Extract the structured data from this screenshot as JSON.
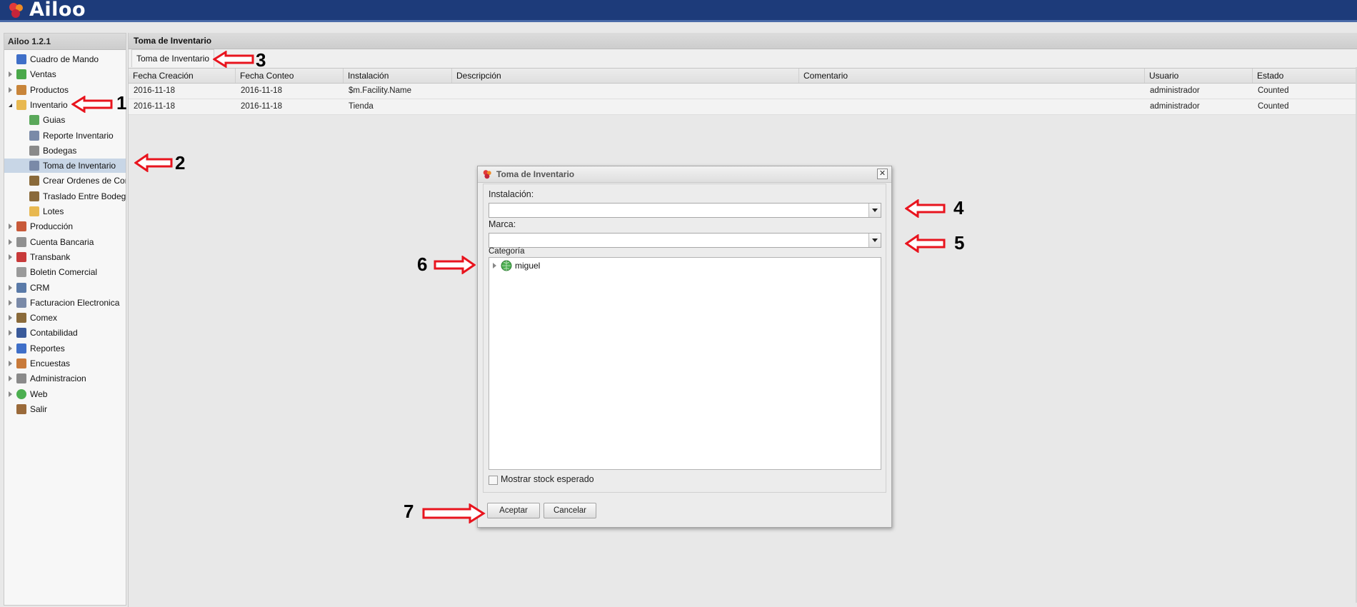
{
  "app": {
    "name": "Ailoo"
  },
  "colors": {
    "topbar": "#1d3b7a",
    "selected": "#c8d6e6",
    "annotation_arrow": "#e8141e"
  },
  "sidebar": {
    "title": "Ailoo 1.2.1",
    "items": [
      {
        "label": "Cuadro de Mando",
        "icon": "chart-icon",
        "expand": "none",
        "indent": 0
      },
      {
        "label": "Ventas",
        "icon": "money-icon",
        "expand": "closed",
        "indent": 0
      },
      {
        "label": "Productos",
        "icon": "box-icon",
        "expand": "closed",
        "indent": 0
      },
      {
        "label": "Inventario",
        "icon": "package-icon",
        "expand": "open",
        "indent": 0
      },
      {
        "label": "Guias",
        "icon": "doc-icon",
        "expand": "none",
        "indent": 1
      },
      {
        "label": "Reporte Inventario",
        "icon": "report-icon",
        "expand": "none",
        "indent": 1
      },
      {
        "label": "Bodegas",
        "icon": "building-icon",
        "expand": "none",
        "indent": 1
      },
      {
        "label": "Toma de Inventario",
        "icon": "report-icon",
        "expand": "none",
        "indent": 1,
        "selected": true
      },
      {
        "label": "Crear Ordenes de Compra",
        "icon": "truck-icon",
        "expand": "none",
        "indent": 1
      },
      {
        "label": "Traslado Entre Bodegas",
        "icon": "truck-icon",
        "expand": "none",
        "indent": 1
      },
      {
        "label": "Lotes",
        "icon": "package-icon",
        "expand": "none",
        "indent": 1
      },
      {
        "label": "Producción",
        "icon": "factory-icon",
        "expand": "closed",
        "indent": 0
      },
      {
        "label": "Cuenta Bancaria",
        "icon": "bank-icon",
        "expand": "closed",
        "indent": 0
      },
      {
        "label": "Transbank",
        "icon": "pin-icon",
        "expand": "closed",
        "indent": 0
      },
      {
        "label": "Boletin Comercial",
        "icon": "tag-icon",
        "expand": "none",
        "indent": 0
      },
      {
        "label": "CRM",
        "icon": "people-icon",
        "expand": "closed",
        "indent": 0
      },
      {
        "label": "Facturacion Electronica",
        "icon": "report-icon",
        "expand": "closed",
        "indent": 0
      },
      {
        "label": "Comex",
        "icon": "truck-icon",
        "expand": "closed",
        "indent": 0
      },
      {
        "label": "Contabilidad",
        "icon": "book-icon",
        "expand": "closed",
        "indent": 0
      },
      {
        "label": "Reportes",
        "icon": "chart-icon",
        "expand": "closed",
        "indent": 0
      },
      {
        "label": "Encuestas",
        "icon": "survey-icon",
        "expand": "closed",
        "indent": 0
      },
      {
        "label": "Administracion",
        "icon": "gear-icon",
        "expand": "closed",
        "indent": 0
      },
      {
        "label": "Web",
        "icon": "globe-icon",
        "expand": "closed",
        "indent": 0
      },
      {
        "label": "Salir",
        "icon": "door-icon",
        "expand": "none",
        "indent": 0
      }
    ]
  },
  "main": {
    "title": "Toma de Inventario",
    "tab": "Toma de Inventario",
    "columns": [
      "Fecha Creación",
      "Fecha Conteo",
      "Instalación",
      "Descripción",
      "Comentario",
      "Usuario",
      "Estado"
    ],
    "rows": [
      [
        "2016-11-18",
        "2016-11-18",
        "$m.Facility.Name",
        "",
        "",
        "administrador",
        "Counted"
      ],
      [
        "2016-11-18",
        "2016-11-18",
        "Tienda",
        "",
        "",
        "administrador",
        "Counted"
      ]
    ]
  },
  "dialog": {
    "title": "Toma de Inventario",
    "close": "✕",
    "instalacion_label": "Instalación:",
    "instalacion_value": "",
    "marca_label": "Marca:",
    "marca_value": "",
    "categoria_label": "Categoría",
    "tree_root": "miguel",
    "stock_checkbox_label": "Mostrar stock esperado",
    "stock_checked": false,
    "accept": "Aceptar",
    "cancel": "Cancelar"
  },
  "annotations": [
    "1",
    "2",
    "3",
    "4",
    "5",
    "6",
    "7"
  ]
}
